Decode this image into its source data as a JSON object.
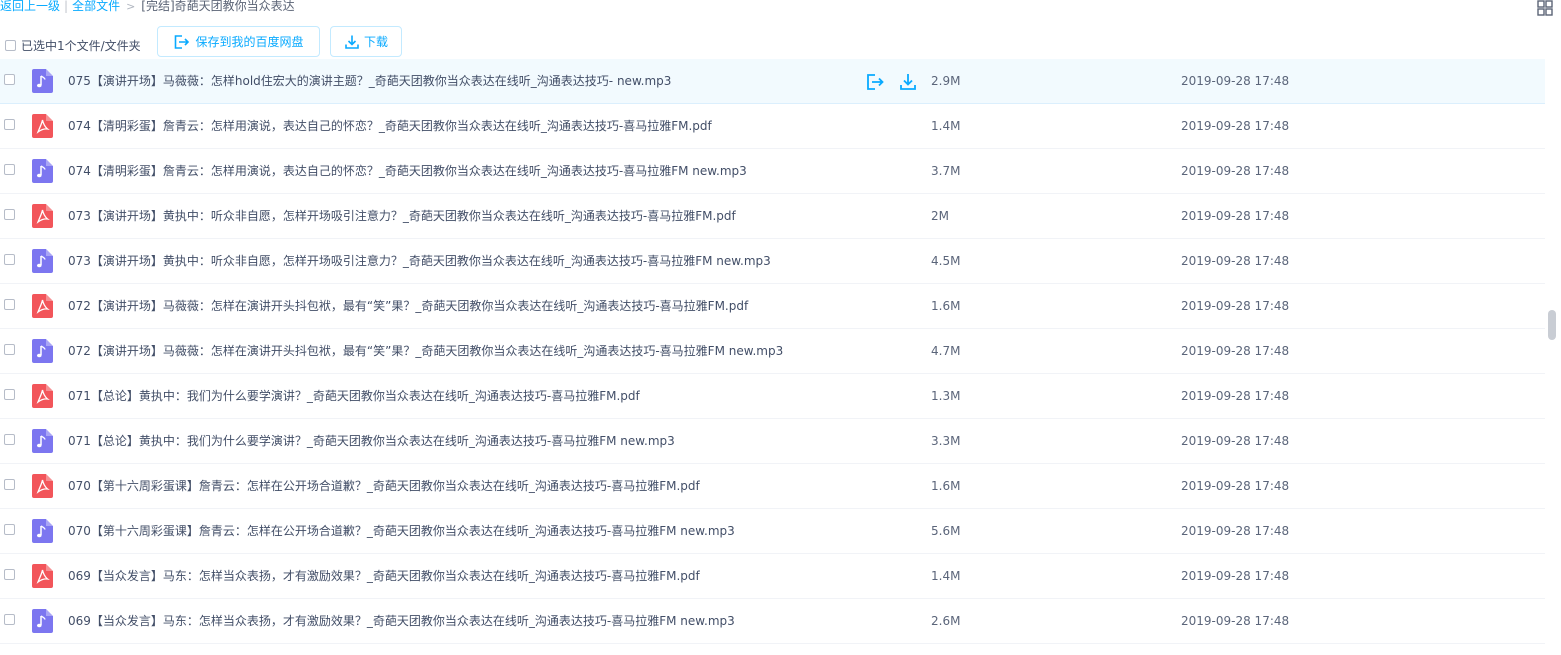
{
  "breadcrumb": {
    "back": "返回上一级",
    "separator": "|",
    "all_files": "全部文件",
    "arrow": ">",
    "current": "[完结]奇葩天团教你当众表达"
  },
  "toolbar": {
    "selected_label": "已选中1个文件/文件夹",
    "save_label": "保存到我的百度网盘",
    "download_label": "下载"
  },
  "colors": {
    "accent": "#09aaff",
    "pdf_icon": "#f2555a",
    "audio_icon": "#7c76f0",
    "row_hover": "#f2fafe"
  },
  "files": [
    {
      "type": "audio",
      "icon": "music-note-icon",
      "name": "075【演讲开场】马薇薇：怎样hold住宏大的演讲主题？_奇葩天团教你当众表达在线听_沟通表达技巧- new.mp3",
      "size": "2.9M",
      "date": "2019-09-28 17:48",
      "hover": true
    },
    {
      "type": "pdf",
      "icon": "pdf-icon",
      "name": "074【清明彩蛋】詹青云：怎样用演说，表达自己的怀恋？_奇葩天团教你当众表达在线听_沟通表达技巧-喜马拉雅FM.pdf",
      "size": "1.4M",
      "date": "2019-09-28 17:48"
    },
    {
      "type": "audio",
      "icon": "music-note-icon",
      "name": "074【清明彩蛋】詹青云：怎样用演说，表达自己的怀恋？_奇葩天团教你当众表达在线听_沟通表达技巧-喜马拉雅FM new.mp3",
      "size": "3.7M",
      "date": "2019-09-28 17:48"
    },
    {
      "type": "pdf",
      "icon": "pdf-icon",
      "name": "073【演讲开场】黄执中：听众非自愿，怎样开场吸引注意力？_奇葩天团教你当众表达在线听_沟通表达技巧-喜马拉雅FM.pdf",
      "size": "2M",
      "date": "2019-09-28 17:48"
    },
    {
      "type": "audio",
      "icon": "music-note-icon",
      "name": "073【演讲开场】黄执中：听众非自愿，怎样开场吸引注意力？_奇葩天团教你当众表达在线听_沟通表达技巧-喜马拉雅FM new.mp3",
      "size": "4.5M",
      "date": "2019-09-28 17:48"
    },
    {
      "type": "pdf",
      "icon": "pdf-icon",
      "name": "072【演讲开场】马薇薇：怎样在演讲开头抖包袱，最有“笑”果？_奇葩天团教你当众表达在线听_沟通表达技巧-喜马拉雅FM.pdf",
      "size": "1.6M",
      "date": "2019-09-28 17:48"
    },
    {
      "type": "audio",
      "icon": "music-note-icon",
      "name": "072【演讲开场】马薇薇：怎样在演讲开头抖包袱，最有“笑”果？_奇葩天团教你当众表达在线听_沟通表达技巧-喜马拉雅FM new.mp3",
      "size": "4.7M",
      "date": "2019-09-28 17:48"
    },
    {
      "type": "pdf",
      "icon": "pdf-icon",
      "name": "071【总论】黄执中：我们为什么要学演讲？_奇葩天团教你当众表达在线听_沟通表达技巧-喜马拉雅FM.pdf",
      "size": "1.3M",
      "date": "2019-09-28 17:48"
    },
    {
      "type": "audio",
      "icon": "music-note-icon",
      "name": "071【总论】黄执中：我们为什么要学演讲？_奇葩天团教你当众表达在线听_沟通表达技巧-喜马拉雅FM new.mp3",
      "size": "3.3M",
      "date": "2019-09-28 17:48"
    },
    {
      "type": "pdf",
      "icon": "pdf-icon",
      "name": "070【第十六周彩蛋课】詹青云：怎样在公开场合道歉？_奇葩天团教你当众表达在线听_沟通表达技巧-喜马拉雅FM.pdf",
      "size": "1.6M",
      "date": "2019-09-28 17:48"
    },
    {
      "type": "audio",
      "icon": "music-note-icon",
      "name": "070【第十六周彩蛋课】詹青云：怎样在公开场合道歉？_奇葩天团教你当众表达在线听_沟通表达技巧-喜马拉雅FM new.mp3",
      "size": "5.6M",
      "date": "2019-09-28 17:48"
    },
    {
      "type": "pdf",
      "icon": "pdf-icon",
      "name": "069【当众发言】马东：怎样当众表扬，才有激励效果？_奇葩天团教你当众表达在线听_沟通表达技巧-喜马拉雅FM.pdf",
      "size": "1.4M",
      "date": "2019-09-28 17:48"
    },
    {
      "type": "audio",
      "icon": "music-note-icon",
      "name": "069【当众发言】马东：怎样当众表扬，才有激励效果？_奇葩天团教你当众表达在线听_沟通表达技巧-喜马拉雅FM new.mp3",
      "size": "2.6M",
      "date": "2019-09-28 17:48"
    }
  ]
}
